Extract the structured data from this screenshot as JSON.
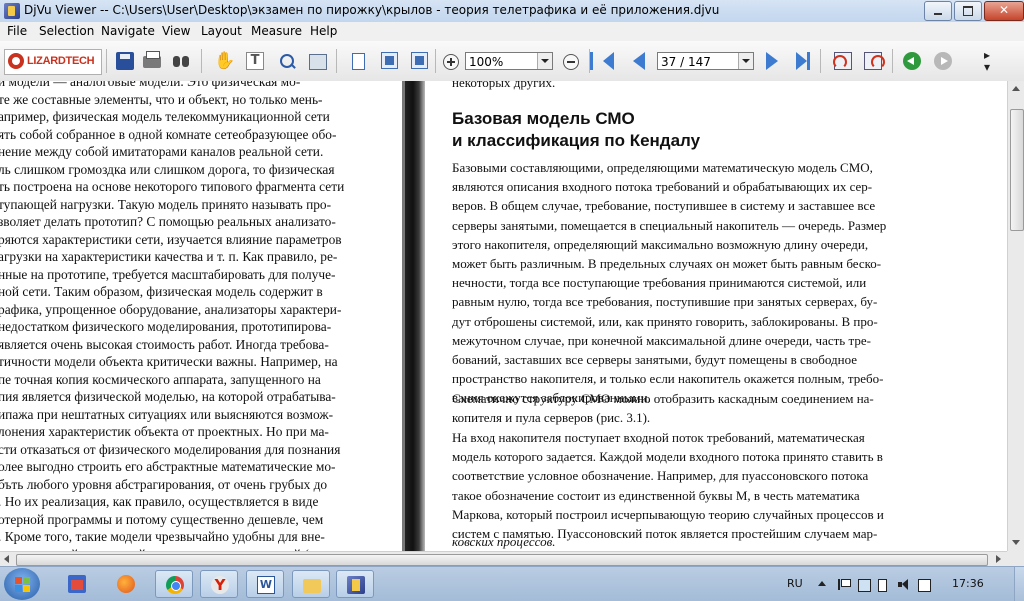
{
  "window": {
    "title": "DjVu Viewer -- C:\\Users\\User\\Desktop\\экзамен по пирожку\\крылов - теория телетрафика и её приложения.djvu"
  },
  "menu": [
    "File",
    "Selection",
    "Navigate",
    "View",
    "Layout",
    "Measure",
    "Help"
  ],
  "toolbar": {
    "logo_text": "LIZARDTECH",
    "zoom_value": "100%",
    "page_value": "37 / 147",
    "icons": [
      "save-icon",
      "print-icon",
      "find-icon",
      "hand-tool-icon",
      "text-select-icon",
      "zoom-select-icon",
      "snapshot-icon",
      "single-page-icon",
      "continuous-page-icon",
      "zoom-in-icon",
      "zoom-out-icon",
      "first-page-icon",
      "previous-page-icon",
      "next-page-icon",
      "last-page-icon",
      "rotate-left-icon",
      "rotate-right-icon",
      "back-icon",
      "forward-icon"
    ]
  },
  "left_page": {
    "lines": [
      "и модели —        аналоговые модели. Это физическая мо-",
      "те же составные элементы, что и объект, но только мень-",
      "апример, физическая модель телекоммуникационной сети",
      "ять собой собранное в одной комнате сетеобразующее обо-",
      "нение между собой имитаторами каналов реальной сети.",
      "ль слишком громоздка или слишком дорога, то физическая",
      "ть построена на основе некоторого типового фрагмента сети",
      "тупающей нагрузки. Такую модель принято называть про-",
      "зволяет делать прототип? С помощью реальных анализато-",
      "ряются характеристики сети, изучается влияние параметров",
      "агрузки на характеристики качества и т. п. Как правило, ре-",
      "нные на прототипе, требуется масштабировать для получе-",
      "ной сети. Таким образом, физическая модель содержит в",
      "рафика, упрощенное оборудование, анализаторы характери-",
      "недостатком физического моделирования, прототипирова-",
      "является очень высокая стоимость работ. Иногда требова-",
      "тичности модели объекта критически важны. Например, на",
      "пе точная копия космического аппарата, запущенного на",
      "пия является физической моделью, на которой отрабатыва-",
      "ипажа при нештатных ситуациях или выясняются возмож-",
      "лонения характеристик объекта от проектных. Но при ма-",
      "сти отказаться от физического моделирования для познания",
      "олее выгодно строить его абстрактные математические мо-",
      "бъть любого уровня абстрагирования, от очень грубых до",
      ". Но их реализация, как правило, осуществляется в виде",
      "отерной программы и потому существенно дешевле, чем",
      ". Кроме того, такие модели чрезвычайно удобны для вне-",
      "ых изменений, измерений, наглядных представлений (на-"
    ]
  },
  "right_page": {
    "top_line": "некоторых других.",
    "heading_line1": "Базовая модель СМО",
    "heading_line2": "и классификация по Кендалу",
    "para1": [
      "Базовыми составляющими, определяющими математическую модель СМО,",
      "являются описания входного потока требований и обрабатывающих их сер-",
      "веров. В общем случае, требование, поступившее в систему и заставшее все",
      "серверы занятыми, помещается в специальный накопитель — очередь. Размер",
      "этого накопителя, определяющий максимально возможную длину очереди,",
      "может быть различным. В предельных случаях он может быть равным беско-",
      "нечности, тогда все поступающие требования принимаются системой, или",
      "равным нулю, тогда все требования, поступившие при занятых серверах, бу-",
      "дут отброшены системой, или, как принято говорить, заблокированы. В про-",
      "межуточном случае, при конечной максимальной длине очереди, часть тре-",
      "бований, заставших все серверы занятыми, будут помещены в свободное",
      "пространство накопителя, и только если накопитель окажется полным, требо-",
      "вания окажутся заблокированными."
    ],
    "para2": [
      "Схематично структуру СМО можно отобразить каскадным соединением на-",
      "копителя и пула серверов (рис. 3.1)."
    ],
    "para3": [
      "На вход накопителя поступает входной поток требований, математическая",
      "модель которого задается. Каждой модели входного потока принято ставить в",
      "соответствие условное обозначение. Например, для пуассоновского потока",
      "такое обозначение состоит из единственной буквы М, в честь математика",
      "Маркова, который построил исчерпывающую теорию случайных процессов и",
      "систем с памятью. Пуассоновский поток является простейшим случаем мар-"
    ],
    "para3_last": "ковских процессов."
  },
  "taskbar": {
    "apps": [
      "start-icon",
      "store-icon",
      "firefox-icon",
      "chrome-icon",
      "yandex-icon",
      "word-icon",
      "explorer-icon",
      "djvu-viewer-icon"
    ],
    "lang": "RU",
    "clock": "17:36"
  }
}
